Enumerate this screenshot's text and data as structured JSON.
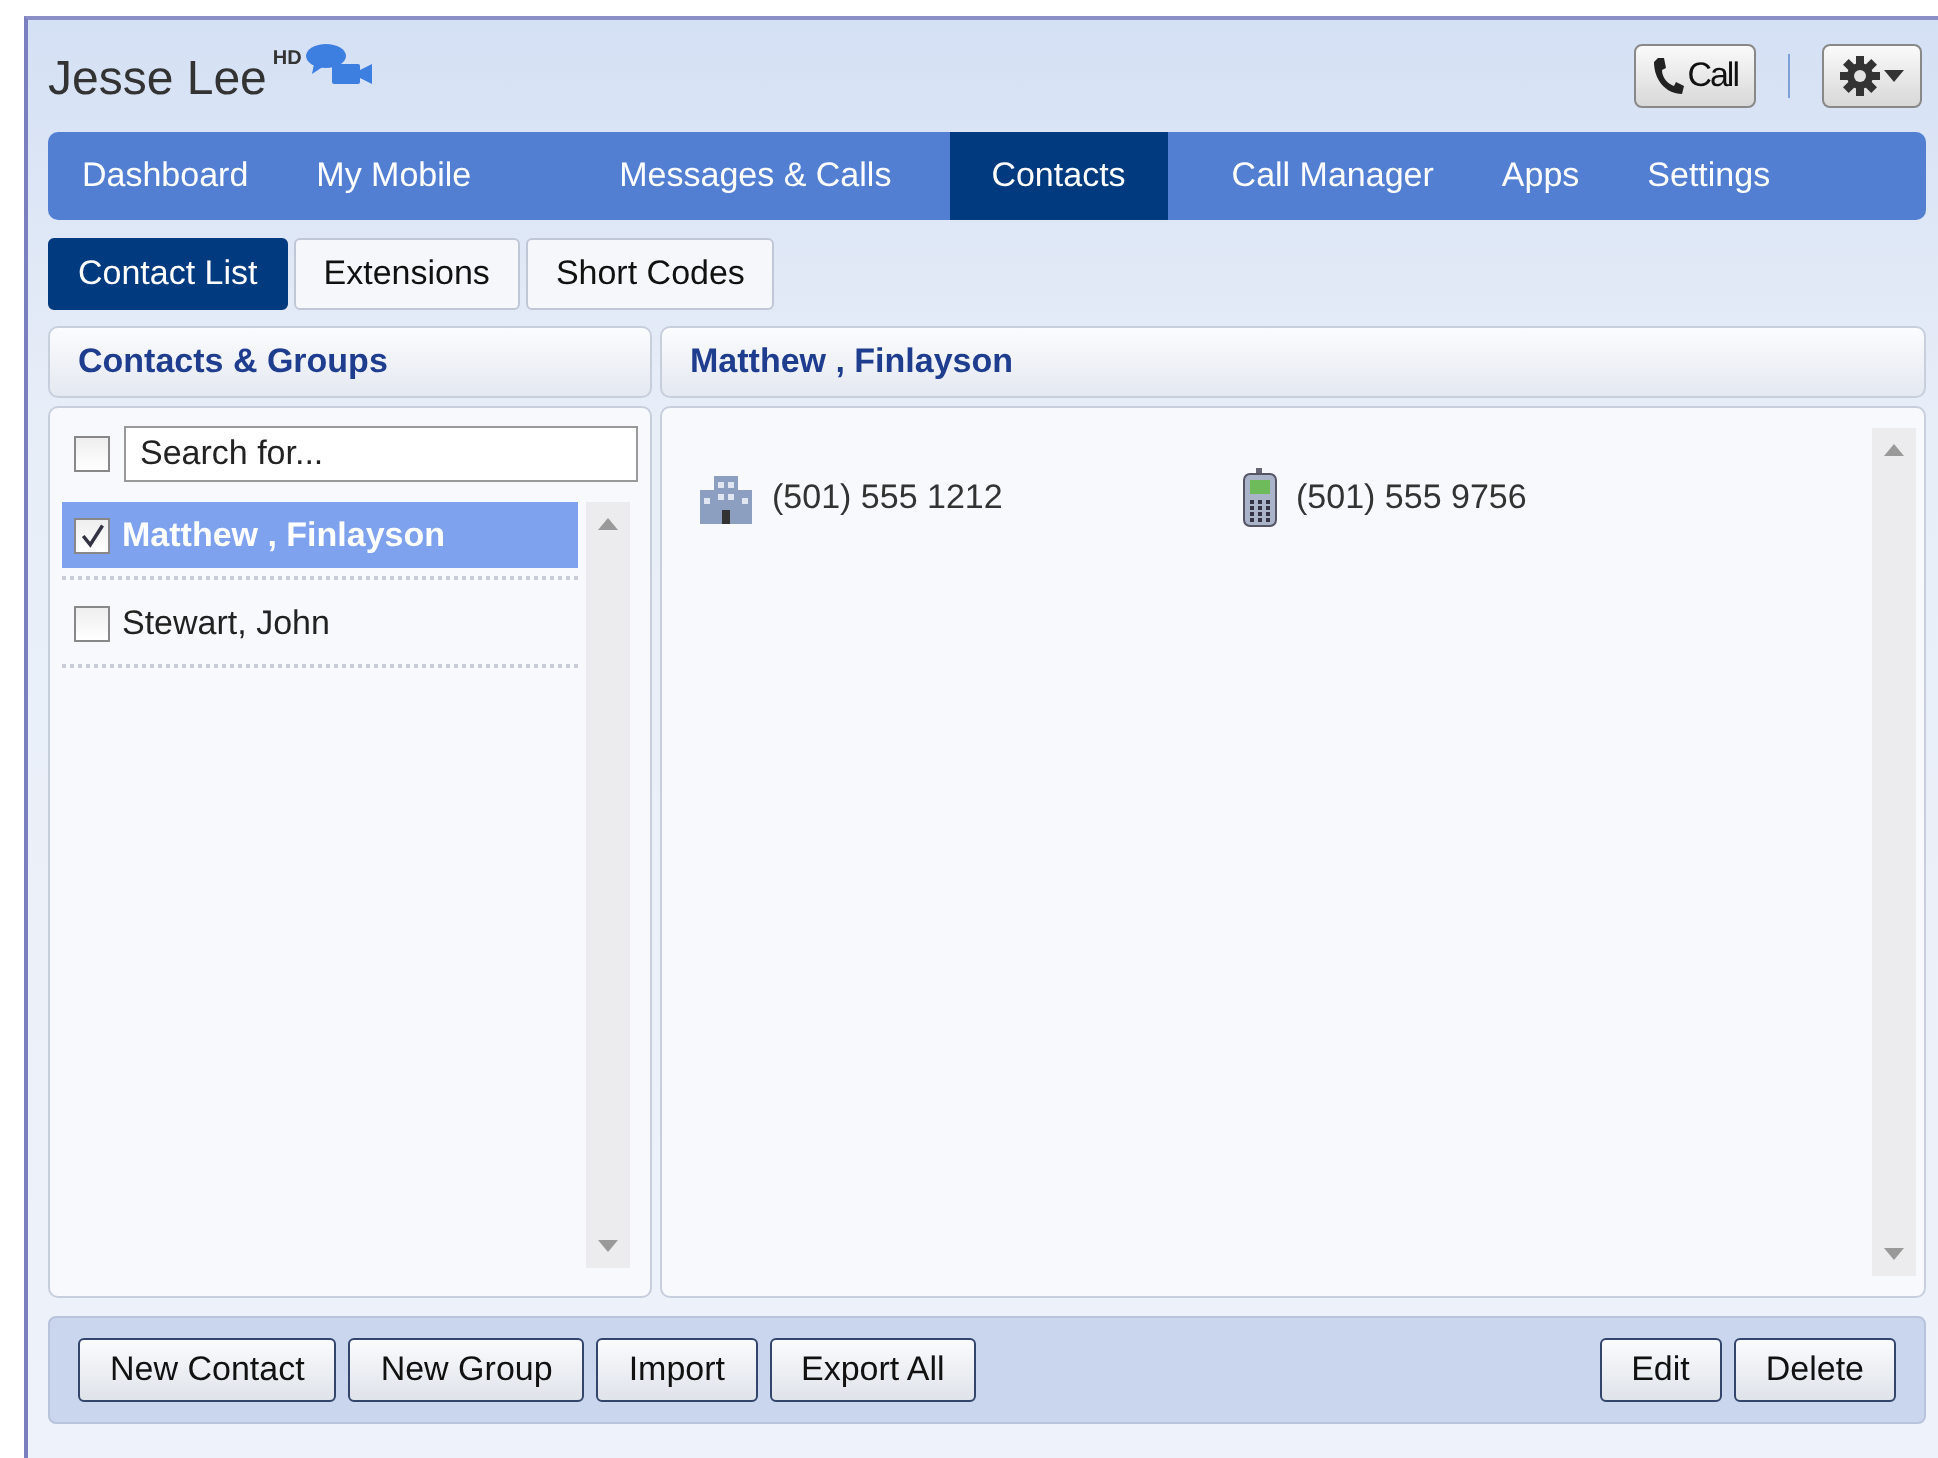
{
  "user": {
    "name": "Jesse Lee",
    "badge": "HD"
  },
  "header_buttons": {
    "call": {
      "label": "Call"
    }
  },
  "nav_tabs": [
    {
      "label": "Dashboard",
      "selected": false
    },
    {
      "label": "My Mobile",
      "selected": false
    },
    {
      "label": "Messages & Calls",
      "selected": false
    },
    {
      "label": "Contacts",
      "selected": true
    },
    {
      "label": "Call Manager",
      "selected": false
    },
    {
      "label": "Apps",
      "selected": false
    },
    {
      "label": "Settings",
      "selected": false
    }
  ],
  "sub_tabs": [
    {
      "label": "Contact List",
      "selected": true
    },
    {
      "label": "Extensions",
      "selected": false
    },
    {
      "label": "Short Codes",
      "selected": false
    }
  ],
  "contacts_panel": {
    "title": "Contacts & Groups",
    "select_all": {
      "checked": false
    },
    "search": {
      "placeholder": "Search for..."
    },
    "contacts": [
      {
        "name": "Matthew , Finlayson",
        "checked": true,
        "selected": true
      },
      {
        "name": "Stewart, John",
        "checked": false,
        "selected": false
      }
    ]
  },
  "detail_panel": {
    "title": "Matthew , Finlayson",
    "phones": [
      {
        "kind": "office",
        "number": "(501) 555 1212"
      },
      {
        "kind": "mobile",
        "number": "(501) 555 9756"
      }
    ]
  },
  "actions": {
    "left": [
      "New Contact",
      "New Group",
      "Import",
      "Export All"
    ],
    "right": [
      "Edit",
      "Delete"
    ]
  }
}
